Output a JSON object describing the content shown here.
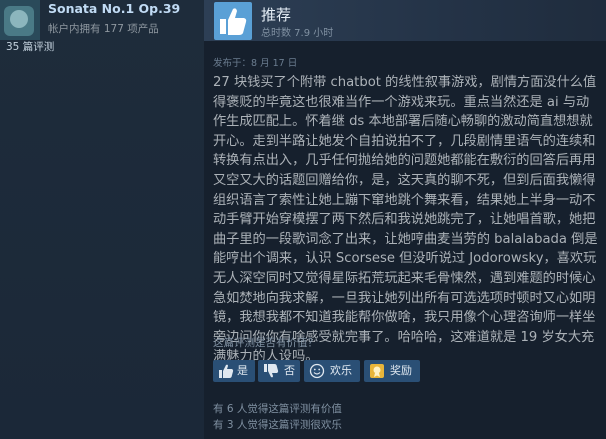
{
  "author": {
    "name": "Sonata No.1 Op.39",
    "owned": "帐户内拥有 177 项产品",
    "reviews": "35 篇评测"
  },
  "review": {
    "verdict": "推荐",
    "hours": "总时数 7.9 小时",
    "posted": "发布于：8 月 17 日",
    "body": "27 块钱买了个附带 chatbot 的线性叙事游戏，剧情方面没什么值得褒贬的毕竟这也很难当作一个游戏来玩。重点当然还是 ai 与动作生成匹配上。怀着继 ds 本地部署后随心畅聊的激动简直想想就开心。走到半路让她发个自拍说拍不了，几段剧情里语气的连续和转换有点出入，几乎任何抛给她的问题她都能在敷衍的回答后再用又空又大的话题回赠给你，是，这天真的聊不死，但到后面我懒得组织语言了索性让她上蹦下窜地跳个舞来看，结果她上半身一动不动手臂开始穿模摆了两下然后和我说她跳完了，让她唱首歌，她把曲子里的一段歌词念了出来，让她哼曲麦当劳的 balalabada 倒是能哼出个调来，认识 Scorsese 但没听说过 Jodorowsky，喜欢玩无人深空同时又觉得星际拓荒玩起来毛骨悚然，遇到难题的时候心急如焚地向我求解，一旦我让她列出所有可选选项时顿时又心如明镜，我想我都不知道我能帮你做啥，我只用像个心理咨询师一样坐旁边问你你有啥感受就完事了。哈哈哈，这难道就是 19 岁女大充满魅力的人设吗。"
  },
  "helpful": {
    "question": "这篇评测是否有价值？",
    "yes": "是",
    "no": "否",
    "funny": "欢乐",
    "award": "奖励",
    "stat_helpful": "有 6 人觉得这篇评测有价值",
    "stat_funny": "有 3 人觉得这篇评测很欢乐"
  },
  "colors": {
    "page_bg": "#1b2838",
    "panel_bg": "#16202d",
    "button_bg": "#2a4f75",
    "thumb_bg": "#5aa0d6"
  }
}
